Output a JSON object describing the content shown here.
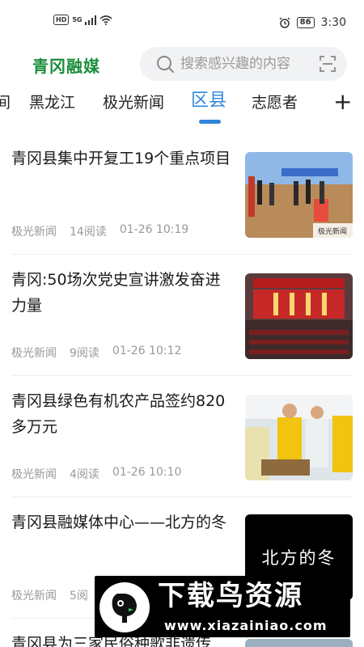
{
  "status_bar": {
    "hd": "HD",
    "signal": "5G",
    "battery": "86",
    "time": "3:30"
  },
  "header": {
    "logo": "青冈融媒",
    "search_placeholder": "搜索感兴趣的内容"
  },
  "tabs": [
    {
      "label": "间"
    },
    {
      "label": "黑龙江"
    },
    {
      "label": "极光新闻"
    },
    {
      "label": "区县"
    },
    {
      "label": "志愿者"
    }
  ],
  "tab_add": "+",
  "news": [
    {
      "title": "青冈县集中开复工19个重点项目",
      "source": "极光新闻",
      "reads": "14阅读",
      "time": "01-26 10:19",
      "thumb_text": "极光新闻"
    },
    {
      "title": "青冈:50场次党史宣讲激发奋进力量",
      "source": "极光新闻",
      "reads": "9阅读",
      "time": "01-26 10:12"
    },
    {
      "title": "青冈县绿色有机农产品签约820多万元",
      "source": "极光新闻",
      "reads": "4阅读",
      "time": "01-26 10:10"
    },
    {
      "title": "青冈县融媒体中心——北方的冬",
      "source": "极光新闻",
      "reads": "5阅",
      "time": "",
      "thumb_text": "北方的冬"
    },
    {
      "title": "青冈县为三家民俗种歌非遗传",
      "source": "",
      "reads": "",
      "time": ""
    }
  ],
  "watermark": {
    "main": "下载鸟资源",
    "url": "www.xiazainiao.com"
  },
  "colors": {
    "brand_green": "#1a8e3a",
    "accent_blue": "#2f86d8"
  }
}
